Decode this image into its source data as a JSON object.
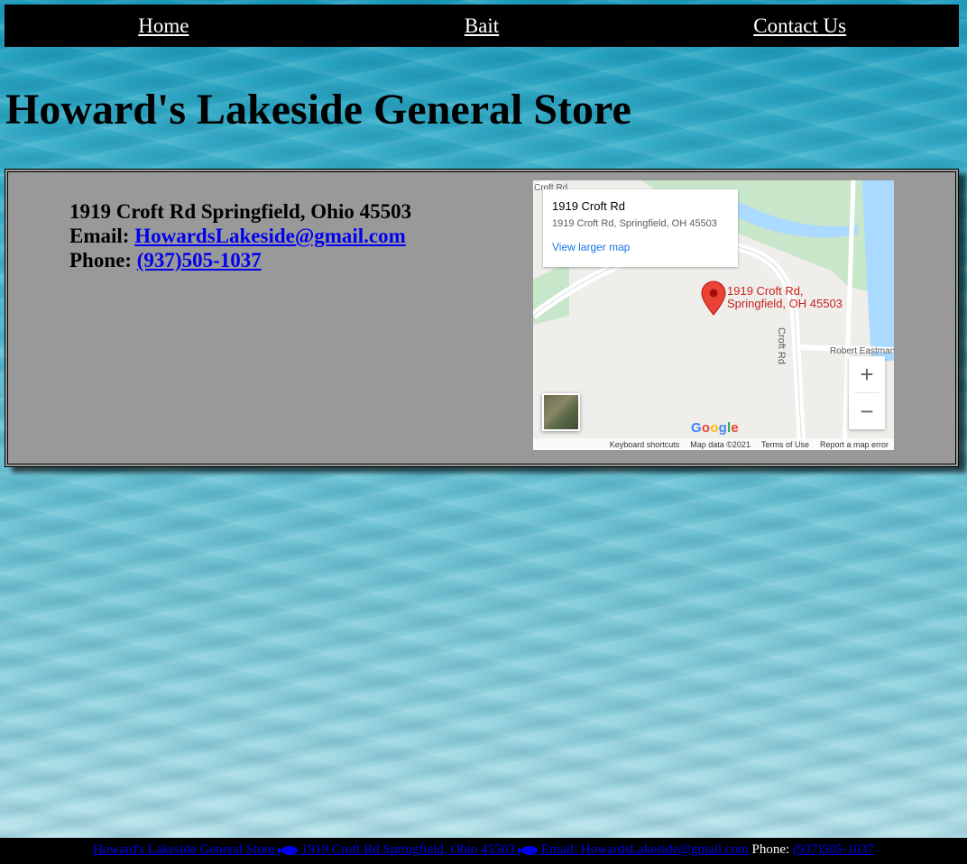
{
  "nav": {
    "items": [
      "Home",
      "Bait",
      "Contact Us"
    ]
  },
  "page_title": "Howard's Lakeside General Store",
  "contact": {
    "address": "1919 Croft Rd Springfield, Ohio 45503",
    "email_label": "Email: ",
    "email": "HowardsLakeside@gmail.com",
    "phone_label": "Phone: ",
    "phone": "(937)505-1037"
  },
  "map": {
    "place_name": "1919 Croft Rd",
    "place_address": "1919 Croft Rd, Springfield, OH 45503",
    "view_larger": "View larger map",
    "pin_label_line1": "1919 Croft Rd,",
    "pin_label_line2": "Springfield, OH 45503",
    "road_croft": "Croft Rd",
    "road_croft_top": "Croft Rd",
    "road_eastman": "Robert Eastman",
    "zoom_in": "+",
    "zoom_out": "−",
    "logo": "Google",
    "keyboard_shortcuts": "Keyboard shortcuts",
    "map_data": "Map data ©2021",
    "terms": "Terms of Use",
    "report": "Report a map error"
  },
  "footer": {
    "store": "Howard's Lakeside General Store ",
    "address": " 1919 Croft Rd Springfield, Ohio 45503 ",
    "email": " Email: HowardsLakeside@gmail.com",
    "phone_label": " Phone: ",
    "phone": "(937)505-1037"
  },
  "colors": {
    "link": "#0000ee",
    "nav_bg": "#000000",
    "panel_bg": "#999999",
    "pin": "#ea4335",
    "water": "#aadaff",
    "park": "#c8e6c9"
  }
}
